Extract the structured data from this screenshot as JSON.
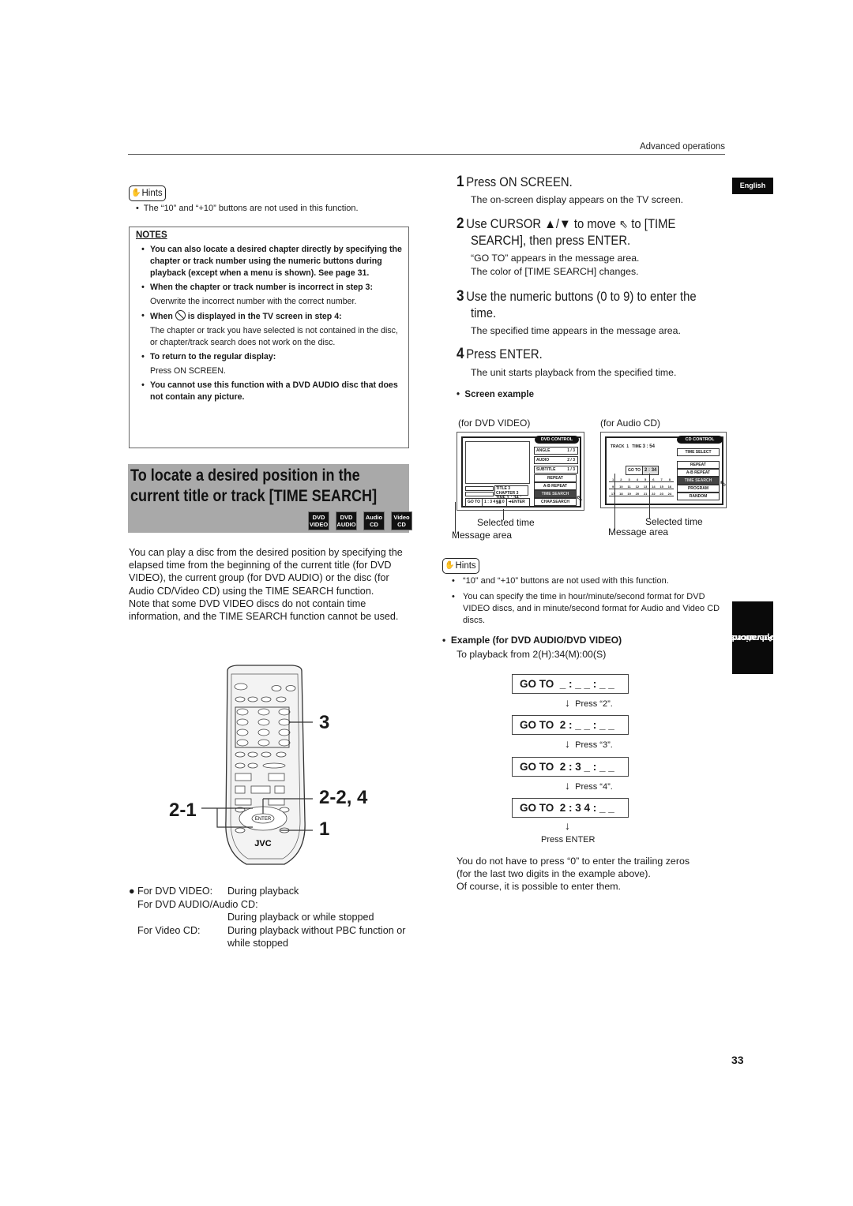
{
  "header": {
    "section": "Advanced operations",
    "language_tab": "English",
    "side_tab": [
      "Advanced",
      "operations"
    ],
    "page_number": "33"
  },
  "left": {
    "hints_label": "Hints",
    "hint_top": "The “10” and “+10” buttons are not used in this function.",
    "notes": {
      "title": "NOTES",
      "items": [
        {
          "bold": "You can also locate a desired chapter directly by specifying the chapter or track number using the numeric buttons during playback (except when a menu is shown). See page 31.",
          "text": ""
        },
        {
          "bold": "When the chapter or track number is incorrect in step 3:",
          "text": "Overwrite the incorrect number with the correct number."
        },
        {
          "bold_pre": "When",
          "bold_post": "is displayed in the TV screen in step 4:",
          "icon": "prohibited-icon",
          "text": "The chapter or track you have selected is not contained in the disc, or chapter/track search does not work on the disc."
        },
        {
          "bold": "To return to the regular display:",
          "text": "Press ON SCREEN."
        },
        {
          "bold": "You cannot use this function with a DVD AUDIO disc that does not contain any picture.",
          "text": ""
        }
      ]
    },
    "section_title_line1": "To locate a desired position in the",
    "section_title_line2": "current title or track [TIME SEARCH]",
    "disc_types": [
      {
        "top": "DVD",
        "bottom": "VIDEO"
      },
      {
        "top": "DVD",
        "bottom": "AUDIO"
      },
      {
        "top": "Audio",
        "bottom": "CD"
      },
      {
        "top": "Video",
        "bottom": "CD"
      }
    ],
    "intro": "You can play a disc from the desired position by specifying the elapsed time from the beginning of the current title (for DVD VIDEO), the current group (for DVD AUDIO) or the disc (for Audio CD/Video CD) using the TIME SEARCH function.",
    "intro2": "Note that some DVD VIDEO discs do not contain time information, and the TIME SEARCH function cannot be used.",
    "remote": {
      "brand": "JVC",
      "callouts": [
        "3",
        "2-2, 4",
        "2-1",
        "1"
      ],
      "enter_label": "ENTER"
    },
    "conditions": [
      {
        "label": "For DVD VIDEO:",
        "value": "During playback"
      },
      {
        "label": "For DVD AUDIO/Audio CD:",
        "value": "During playback or while stopped"
      },
      {
        "label": "For Video CD:",
        "value": "During playback without PBC function or while stopped"
      }
    ]
  },
  "right": {
    "steps": [
      {
        "num": "1",
        "title": "Press ON SCREEN.",
        "desc": [
          "The on-screen display appears on the TV screen."
        ]
      },
      {
        "num": "2",
        "title_a": "Use CURSOR ▲/▼ to move",
        "title_b": "to [TIME",
        "title_c": "SEARCH],  then press ENTER.",
        "desc": [
          "“GO TO” appears in the message area.",
          "The color of [TIME SEARCH] changes."
        ]
      },
      {
        "num": "3",
        "title": "Use the numeric buttons (0 to 9) to enter the",
        "title2": "time.",
        "desc": [
          "The specified time appears in the message area."
        ]
      },
      {
        "num": "4",
        "title": "Press ENTER.",
        "desc": [
          "The unit starts playback from the specified time."
        ]
      }
    ],
    "screen_example": "Screen example",
    "dvd_screen": {
      "caption": "for DVD VIDEO",
      "header": "DVD CONTROL",
      "settings": [
        {
          "label": "ANGLE",
          "value": "1 / 3"
        },
        {
          "label": "AUDIO",
          "value": "2 / 3"
        },
        {
          "label": "SUBTITLE",
          "value": "1 / 3"
        }
      ],
      "menu": [
        "REPEAT",
        "A-B REPEAT",
        "TIME SEARCH",
        "CHAP.SEARCH"
      ],
      "title_label": "TITLE",
      "title_value": "3",
      "chapter_label": "CHAPTER",
      "chapter_value": "3",
      "time_label": "TIME",
      "time_value": "1 : 34 : 58",
      "goto_label": "GO TO",
      "goto_value": "1 : 3 4 : 0 0",
      "enter_label": "➔ENTER",
      "selected_time": "Selected time",
      "message_area": "Message area"
    },
    "cd_screen": {
      "caption": "for Audio CD",
      "header": "CD CONTROL",
      "track_label": "TRACK",
      "track_value": "1",
      "time_label": "TIME",
      "time_value": "3 : 54",
      "menu": [
        "TIME SELECT",
        "REPEAT",
        "A-B REPEAT",
        "TIME SEARCH",
        "PROGRAM",
        "RANDOM"
      ],
      "goto_label": "GO TO",
      "goto_value": "2 : 34",
      "tracks": [
        "1",
        "2",
        "3",
        "4",
        "5",
        "6",
        "7",
        "8",
        "9",
        "10",
        "11",
        "12",
        "13",
        "14",
        "15",
        "16",
        "17",
        "18",
        "19",
        "20",
        "21",
        "22",
        "23",
        "24"
      ],
      "selected_time": "Selected time",
      "message_area": "Message area"
    },
    "hints_label": "Hints",
    "hints": [
      "“10” and “+10” buttons are not used with this function.",
      "You can specify the time in hour/minute/second format for DVD VIDEO discs, and in minute/second format for Audio and Video CD discs."
    ],
    "example_title": "Example (for DVD AUDIO/DVD VIDEO)",
    "example_desc": "To playback from 2(H):34(M):00(S)",
    "goto_sequence": [
      "GO TO  _ : _ _ : _ _",
      "GO TO  2 : _ _ : _ _",
      "GO TO  2 : 3 _ : _ _",
      "GO TO  2 : 3 4 : _ _"
    ],
    "presses": [
      "Press “2”.",
      "Press “3”.",
      "Press “4”.",
      "Press ENTER"
    ],
    "footer_note": [
      "You do not have to press “0” to enter the trailing zeros",
      "(for the last two digits in the example above).",
      "Of course, it is possible to enter them."
    ]
  }
}
